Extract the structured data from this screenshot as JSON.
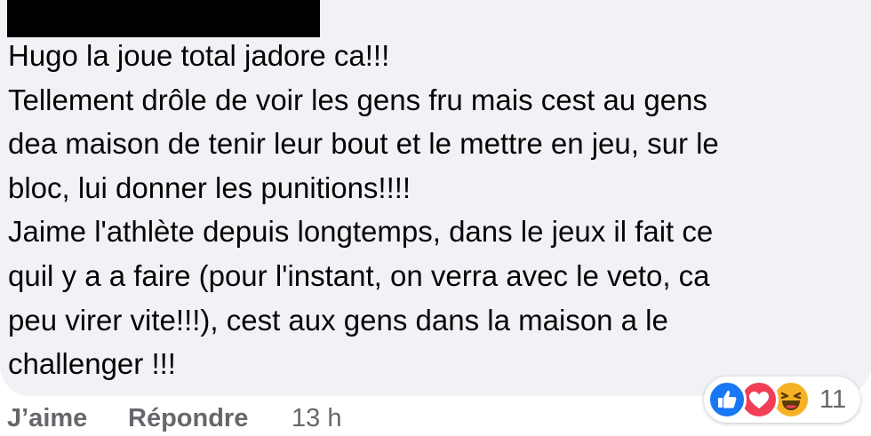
{
  "comment": {
    "lines": [
      "Hugo la joue total jadore ca!!!",
      "Tellement drôle de voir les gens fru mais cest au gens",
      "dea maison de tenir leur bout et le mettre en jeu, sur le",
      "bloc, lui donner les punitions!!!!",
      "Jaime l'athlète depuis longtemps, dans le jeux il fait ce",
      "quil y a a faire (pour l'instant, on verra avec le veto, ca",
      "peu virer vite!!!), cest aux gens dans la maison a le",
      "challenger !!!"
    ]
  },
  "reactions": {
    "icons": [
      "like-icon",
      "love-icon",
      "haha-icon"
    ],
    "count": "11",
    "colors": {
      "like": "#1877f2",
      "love": "#f33e58",
      "haha": "#f7b125"
    }
  },
  "actions": {
    "like_label": "J’aime",
    "reply_label": "Répondre",
    "timestamp": "13 h"
  },
  "colors": {
    "bubble_bg": "#f0f2f5",
    "text": "#050505",
    "secondary_text": "#65676b"
  }
}
